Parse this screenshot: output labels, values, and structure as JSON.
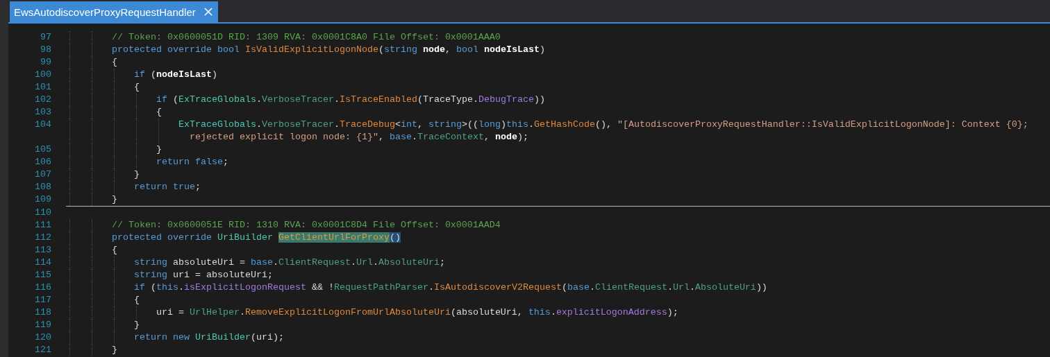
{
  "tab": {
    "title": "EwsAutodiscoverProxyRequestHandler",
    "selected": true
  },
  "lines": [
    {
      "number": "97",
      "rule_above": false,
      "tokens": [
        {
          "kind": "comment",
          "t": "        // Token: 0x0600051D RID: 1309 RVA: 0x0001C8A0 File Offset: 0x0001AAA0"
        }
      ]
    },
    {
      "number": "98",
      "rule_above": false,
      "tokens": [
        {
          "kind": "kw",
          "t": "        protected override bool "
        },
        {
          "kind": "method",
          "t": "IsValidExplicitLogonNode"
        },
        {
          "kind": "plain",
          "t": "("
        },
        {
          "kind": "kw",
          "t": "string "
        },
        {
          "kind": "param",
          "t": "node"
        },
        {
          "kind": "plain",
          "t": ", "
        },
        {
          "kind": "kw",
          "t": "bool "
        },
        {
          "kind": "param",
          "t": "nodeIsLast"
        },
        {
          "kind": "plain",
          "t": ")"
        }
      ]
    },
    {
      "number": "99",
      "rule_above": false,
      "tokens": [
        {
          "kind": "plain",
          "t": "        {"
        }
      ]
    },
    {
      "number": "100",
      "rule_above": false,
      "tokens": [
        {
          "kind": "kw",
          "t": "            if "
        },
        {
          "kind": "plain",
          "t": "("
        },
        {
          "kind": "param",
          "t": "nodeIsLast"
        },
        {
          "kind": "plain",
          "t": ")"
        }
      ]
    },
    {
      "number": "101",
      "rule_above": false,
      "tokens": [
        {
          "kind": "plain",
          "t": "            {"
        }
      ]
    },
    {
      "number": "102",
      "rule_above": false,
      "tokens": [
        {
          "kind": "kw",
          "t": "                if "
        },
        {
          "kind": "plain",
          "t": "("
        },
        {
          "kind": "type",
          "t": "ExTraceGlobals"
        },
        {
          "kind": "plain",
          "t": "."
        },
        {
          "kind": "prop",
          "t": "VerboseTracer"
        },
        {
          "kind": "plain",
          "t": "."
        },
        {
          "kind": "method",
          "t": "IsTraceEnabled"
        },
        {
          "kind": "plain",
          "t": "("
        },
        {
          "kind": "plain",
          "t": "TraceType."
        },
        {
          "kind": "field",
          "t": "DebugTrace"
        },
        {
          "kind": "plain",
          "t": "))"
        }
      ]
    },
    {
      "number": "103",
      "rule_above": false,
      "tokens": [
        {
          "kind": "plain",
          "t": "                {"
        }
      ]
    },
    {
      "number": "104",
      "rule_above": false,
      "tokens": [
        {
          "kind": "type",
          "t": "                    ExTraceGlobals"
        },
        {
          "kind": "plain",
          "t": "."
        },
        {
          "kind": "prop",
          "t": "VerboseTracer"
        },
        {
          "kind": "plain",
          "t": "."
        },
        {
          "kind": "method",
          "t": "TraceDebug"
        },
        {
          "kind": "plain",
          "t": "<"
        },
        {
          "kind": "kw",
          "t": "int"
        },
        {
          "kind": "plain",
          "t": ", "
        },
        {
          "kind": "kw",
          "t": "string"
        },
        {
          "kind": "plain",
          "t": ">(("
        },
        {
          "kind": "kw",
          "t": "long"
        },
        {
          "kind": "plain",
          "t": ")"
        },
        {
          "kind": "kw",
          "t": "this"
        },
        {
          "kind": "plain",
          "t": "."
        },
        {
          "kind": "method",
          "t": "GetHashCode"
        },
        {
          "kind": "plain",
          "t": "(), "
        },
        {
          "kind": "string",
          "t": "\"[AutodiscoverProxyRequestHandler::IsValidExplicitLogonNode]: Context {0};"
        }
      ],
      "wrap_tokens": [
        {
          "kind": "string",
          "t": "                      rejected explicit logon node: {1}\""
        },
        {
          "kind": "plain",
          "t": ", "
        },
        {
          "kind": "kw",
          "t": "base"
        },
        {
          "kind": "plain",
          "t": "."
        },
        {
          "kind": "prop",
          "t": "TraceContext"
        },
        {
          "kind": "plain",
          "t": ", "
        },
        {
          "kind": "param",
          "t": "node"
        },
        {
          "kind": "plain",
          "t": ");"
        }
      ]
    },
    {
      "number": "105",
      "rule_above": false,
      "tokens": [
        {
          "kind": "plain",
          "t": "                }"
        }
      ]
    },
    {
      "number": "106",
      "rule_above": false,
      "tokens": [
        {
          "kind": "kw",
          "t": "                return false"
        },
        {
          "kind": "plain",
          "t": ";"
        }
      ]
    },
    {
      "number": "107",
      "rule_above": false,
      "tokens": [
        {
          "kind": "plain",
          "t": "            }"
        }
      ]
    },
    {
      "number": "108",
      "rule_above": false,
      "tokens": [
        {
          "kind": "kw",
          "t": "            return true"
        },
        {
          "kind": "plain",
          "t": ";"
        }
      ]
    },
    {
      "number": "109",
      "rule_above": false,
      "tokens": [
        {
          "kind": "plain",
          "t": "        }"
        }
      ]
    },
    {
      "number": "110",
      "rule_above": true
    },
    {
      "number": "111",
      "rule_above": false,
      "tokens": [
        {
          "kind": "comment",
          "t": "        // Token: 0x0600051E RID: 1310 RVA: 0x0001C8D4 File Offset: 0x0001AAD4"
        }
      ]
    },
    {
      "number": "112",
      "rule_above": false,
      "tokens": [
        {
          "kind": "kw",
          "t": "        protected override "
        },
        {
          "kind": "type",
          "t": "UriBuilder "
        },
        {
          "kind": "highlight",
          "t": "GetClientUrlForProxy"
        },
        {
          "kind": "match",
          "t": "()"
        }
      ]
    },
    {
      "number": "113",
      "rule_above": false,
      "tokens": [
        {
          "kind": "plain",
          "t": "        {"
        }
      ]
    },
    {
      "number": "114",
      "rule_above": false,
      "tokens": [
        {
          "kind": "kw",
          "t": "            string "
        },
        {
          "kind": "plain",
          "t": "absoluteUri = "
        },
        {
          "kind": "kw",
          "t": "base"
        },
        {
          "kind": "plain",
          "t": "."
        },
        {
          "kind": "prop",
          "t": "ClientRequest"
        },
        {
          "kind": "plain",
          "t": "."
        },
        {
          "kind": "prop",
          "t": "Url"
        },
        {
          "kind": "plain",
          "t": "."
        },
        {
          "kind": "prop",
          "t": "AbsoluteUri"
        },
        {
          "kind": "plain",
          "t": ";"
        }
      ]
    },
    {
      "number": "115",
      "rule_above": false,
      "tokens": [
        {
          "kind": "kw",
          "t": "            string "
        },
        {
          "kind": "plain",
          "t": "uri = absoluteUri;"
        }
      ]
    },
    {
      "number": "116",
      "rule_above": false,
      "tokens": [
        {
          "kind": "kw",
          "t": "            if "
        },
        {
          "kind": "plain",
          "t": "("
        },
        {
          "kind": "kw",
          "t": "this"
        },
        {
          "kind": "plain",
          "t": "."
        },
        {
          "kind": "field",
          "t": "isExplicitLogonRequest"
        },
        {
          "kind": "plain",
          "t": " && !"
        },
        {
          "kind": "prop",
          "t": "RequestPathParser"
        },
        {
          "kind": "plain",
          "t": "."
        },
        {
          "kind": "method",
          "t": "IsAutodiscoverV2Request"
        },
        {
          "kind": "plain",
          "t": "("
        },
        {
          "kind": "kw",
          "t": "base"
        },
        {
          "kind": "plain",
          "t": "."
        },
        {
          "kind": "prop",
          "t": "ClientRequest"
        },
        {
          "kind": "plain",
          "t": "."
        },
        {
          "kind": "prop",
          "t": "Url"
        },
        {
          "kind": "plain",
          "t": "."
        },
        {
          "kind": "prop",
          "t": "AbsoluteUri"
        },
        {
          "kind": "plain",
          "t": "))"
        }
      ]
    },
    {
      "number": "117",
      "rule_above": false,
      "tokens": [
        {
          "kind": "plain",
          "t": "            {"
        }
      ]
    },
    {
      "number": "118",
      "rule_above": false,
      "tokens": [
        {
          "kind": "plain",
          "t": "                uri = "
        },
        {
          "kind": "prop",
          "t": "UrlHelper"
        },
        {
          "kind": "plain",
          "t": "."
        },
        {
          "kind": "method",
          "t": "RemoveExplicitLogonFromUrlAbsoluteUri"
        },
        {
          "kind": "plain",
          "t": "(absoluteUri, "
        },
        {
          "kind": "kw",
          "t": "this"
        },
        {
          "kind": "plain",
          "t": "."
        },
        {
          "kind": "field",
          "t": "explicitLogonAddress"
        },
        {
          "kind": "plain",
          "t": ");"
        }
      ]
    },
    {
      "number": "119",
      "rule_above": false,
      "tokens": [
        {
          "kind": "plain",
          "t": "            }"
        }
      ]
    },
    {
      "number": "120",
      "rule_above": false,
      "tokens": [
        {
          "kind": "kw",
          "t": "            return new "
        },
        {
          "kind": "type",
          "t": "UriBuilder"
        },
        {
          "kind": "plain",
          "t": "(uri);"
        }
      ]
    },
    {
      "number": "121",
      "rule_above": false,
      "tokens": [
        {
          "kind": "plain",
          "t": "        }"
        }
      ]
    }
  ]
}
